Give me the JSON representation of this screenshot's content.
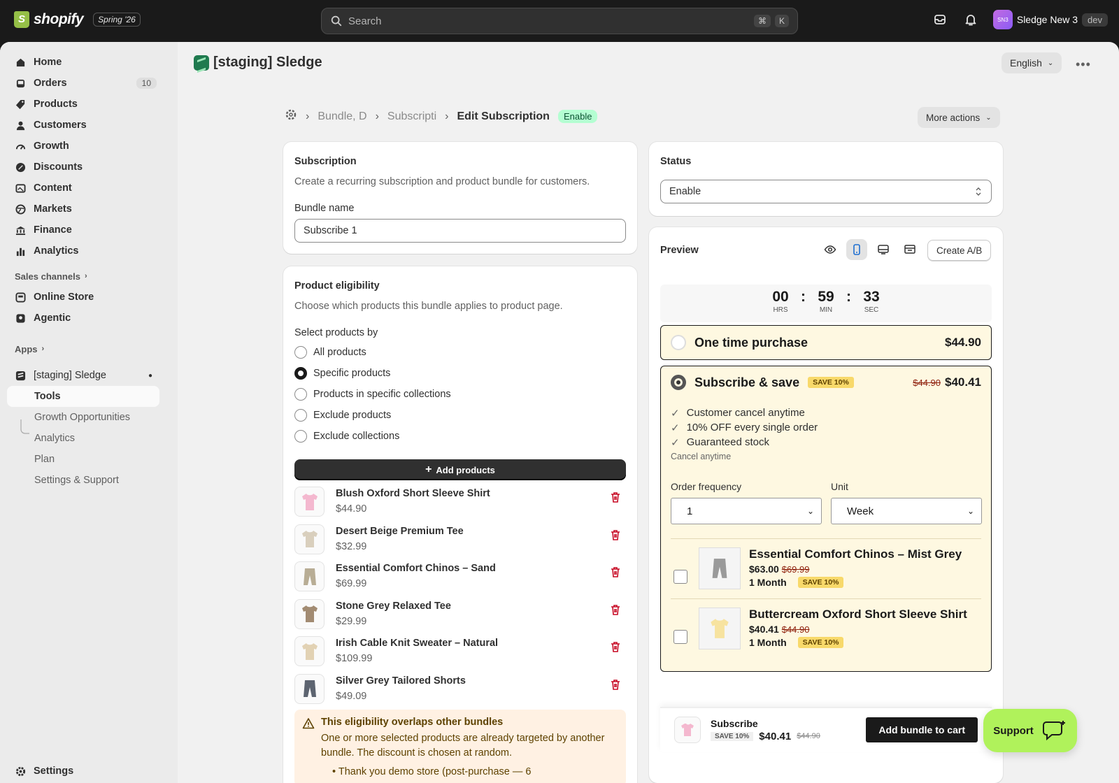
{
  "topbar": {
    "brand": "shopify",
    "version": "Spring '26",
    "search_placeholder": "Search",
    "kbd_cmd": "⌘",
    "kbd_k": "K",
    "store_initials": "SN3",
    "store_name": "Sledge New 3",
    "env": "dev"
  },
  "sidebar": {
    "items": [
      {
        "label": "Home",
        "icon": "home-icon"
      },
      {
        "label": "Orders",
        "icon": "orders-icon",
        "badge": "10"
      },
      {
        "label": "Products",
        "icon": "tag-icon"
      },
      {
        "label": "Customers",
        "icon": "person-icon"
      },
      {
        "label": "Growth",
        "icon": "gauge-icon"
      },
      {
        "label": "Discounts",
        "icon": "discount-icon"
      },
      {
        "label": "Content",
        "icon": "content-icon"
      },
      {
        "label": "Markets",
        "icon": "globe-icon"
      },
      {
        "label": "Finance",
        "icon": "bank-icon"
      },
      {
        "label": "Analytics",
        "icon": "bar-chart-icon"
      }
    ],
    "sales_channels_label": "Sales channels",
    "channels": [
      {
        "label": "Online Store",
        "icon": "store-icon"
      },
      {
        "label": "Agentic",
        "icon": "agent-icon"
      }
    ],
    "apps_label": "Apps",
    "app_name": "[staging] Sledge",
    "app_sub": [
      "Tools",
      "Growth Opportunities",
      "Analytics",
      "Plan",
      "Settings & Support"
    ],
    "settings_label": "Settings"
  },
  "header": {
    "app_title": "[staging] Sledge",
    "language": "English"
  },
  "breadcrumb": {
    "c1": "Bundle, D",
    "c2": "Subscripti",
    "current": "Edit Subscription",
    "status_badge": "Enable",
    "more_actions": "More actions"
  },
  "subscription_card": {
    "title": "Subscription",
    "desc": "Create a recurring subscription and product bundle for customers.",
    "bundle_label": "Bundle name",
    "bundle_value": "Subscribe 1"
  },
  "eligibility": {
    "title": "Product eligibility",
    "desc": "Choose which products this bundle applies to product page.",
    "select_label": "Select products by",
    "options": [
      "All products",
      "Specific products",
      "Products in specific collections",
      "Exclude products",
      "Exclude collections"
    ],
    "selected_index": 1,
    "add_button": "Add products",
    "products": [
      {
        "name": "Blush Oxford Short Sleeve Shirt",
        "price": "$44.90",
        "color": "#f4b8cf"
      },
      {
        "name": "Desert Beige Premium Tee",
        "price": "$32.99",
        "color": "#d9cfbd"
      },
      {
        "name": "Essential Comfort Chinos – Sand",
        "price": "$69.99",
        "color": "#b8ad95"
      },
      {
        "name": "Stone Grey Relaxed Tee",
        "price": "$29.99",
        "color": "#a28b72"
      },
      {
        "name": "Irish Cable Knit Sweater – Natural",
        "price": "$109.99",
        "color": "#e2d2b4"
      },
      {
        "name": "Silver Grey Tailored Shorts",
        "price": "$49.09",
        "color": "#5d6470"
      }
    ],
    "warning_title": "This eligibility overlaps other bundles",
    "warning_desc": "One or more selected products are already targeted by another bundle. The discount is chosen at random.",
    "warning_item": "Thank you demo store (post-purchase — 6"
  },
  "status_card": {
    "title": "Status",
    "value": "Enable"
  },
  "preview": {
    "title": "Preview",
    "create_ab": "Create A/B",
    "timer": {
      "hrs": "00",
      "min": "59",
      "sec": "33",
      "hrs_label": "HRS",
      "min_label": "MIN",
      "sec_label": "SEC",
      "sep": ":"
    },
    "one_time_label": "One time purchase",
    "one_time_price": "$44.90",
    "subscribe_label": "Subscribe & save",
    "save_badge": "SAVE 10%",
    "orig_price": "$44.90",
    "sub_price": "$40.41",
    "benefits": [
      "Customer cancel anytime",
      "10% OFF every single order",
      "Guaranteed stock"
    ],
    "cancel_note": "Cancel anytime",
    "freq_label": "Order frequency",
    "unit_label": "Unit",
    "freq_value": "1",
    "unit_value": "Week",
    "upsells": [
      {
        "name": "Essential Comfort Chinos – Mist Grey",
        "price": "$63.00",
        "orig": "$69.99",
        "period": "1 Month",
        "badge": "SAVE 10%",
        "color": "#9a9a9a"
      },
      {
        "name": "Buttercream Oxford Short Sleeve Shirt",
        "price": "$40.41",
        "orig": "$44.90",
        "period": "1 Month",
        "badge": "SAVE 10%",
        "color": "#f7e3a0"
      }
    ],
    "sticky": {
      "label": "Subscribe",
      "badge": "SAVE 10%",
      "price": "$40.41",
      "orig": "$44.90",
      "button": "Add bundle to cart"
    }
  },
  "support": {
    "label": "Support"
  }
}
